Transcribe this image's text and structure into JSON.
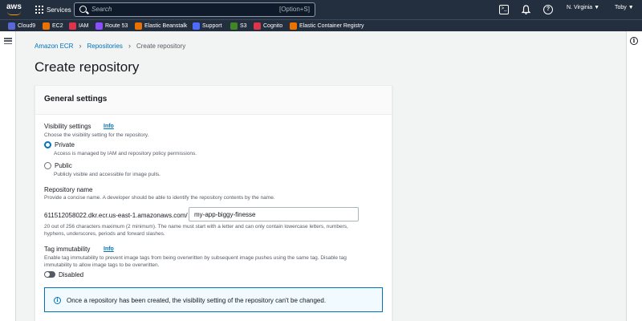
{
  "topnav": {
    "logo": "aws",
    "services_label": "Services",
    "search_placeholder": "Search",
    "search_shortcut": "[Option+S]",
    "region": "N. Virginia ▼",
    "user": "Toby ▼"
  },
  "favorites": [
    {
      "label": "Cloud9",
      "color": "#5a67d8"
    },
    {
      "label": "EC2",
      "color": "#ed7100"
    },
    {
      "label": "IAM",
      "color": "#dd344c"
    },
    {
      "label": "Route 53",
      "color": "#8c4fff"
    },
    {
      "label": "Elastic Beanstalk",
      "color": "#ed7100"
    },
    {
      "label": "Support",
      "color": "#4d6bfe"
    },
    {
      "label": "S3",
      "color": "#3f8624"
    },
    {
      "label": "Cognito",
      "color": "#dd344c"
    },
    {
      "label": "Elastic Container Registry",
      "color": "#ed7100"
    }
  ],
  "breadcrumb": {
    "item1": "Amazon ECR",
    "item2": "Repositories",
    "current": "Create repository"
  },
  "page_title": "Create repository",
  "general": {
    "title": "General settings",
    "visibility": {
      "label": "Visibility settings",
      "info": "Info",
      "desc": "Choose the visibility setting for the repository.",
      "private_label": "Private",
      "private_desc": "Access is managed by IAM and repository policy permissions.",
      "public_label": "Public",
      "public_desc": "Publicly visible and accessible for image pulls.",
      "selected": "Private"
    },
    "repo_name": {
      "label": "Repository name",
      "desc": "Provide a concise name. A developer should be able to identify the repository contents by the name.",
      "prefix": "611512058022.dkr.ecr.us-east-1.amazonaws.com/",
      "value": "my-app-biggy-finesse",
      "constraint_line1": "20 out of 256 characters maximum (2 minimum). The name must start with a letter and can only contain lowercase letters, numbers,",
      "constraint_line2": "hyphens, underscores, periods and forward slashes."
    },
    "tag_immutability": {
      "label": "Tag immutability",
      "info": "Info",
      "desc_line1": "Enable tag immutability to prevent image tags from being overwritten by subsequent image pushes using the same tag. Disable tag",
      "desc_line2": "immutability to allow image tags to be overwritten.",
      "toggle_label": "Disabled"
    },
    "alert": "Once a repository has been created, the visibility setting of the repository can't be changed."
  }
}
